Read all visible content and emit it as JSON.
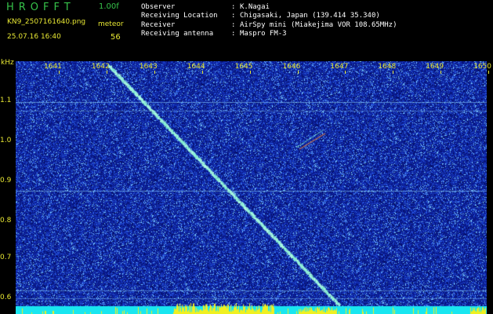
{
  "header": {
    "app_title": "HROFFT",
    "version": "1.00f",
    "filename": "KN9_2507161640.png",
    "datetime": "25.07.16 16:40",
    "mode_label": "meteor",
    "mode_value": "56"
  },
  "info": [
    {
      "label": "Observer",
      "sep": ":",
      "value": "K.Nagai"
    },
    {
      "label": "Receiving Location",
      "sep": ":",
      "value": "Chigasaki, Japan (139.414 35.340)"
    },
    {
      "label": "Receiver",
      "sep": ":",
      "value": "AirSpy mini (Miakejima VOR 108.65MHz)"
    },
    {
      "label": "Receiving antenna",
      "sep": ":",
      "value": "Maspro FM-3"
    }
  ],
  "spectrogram": {
    "y_unit": "kHz",
    "y_ticks": [
      "1.1",
      "1.0",
      "0.9",
      "0.8",
      "0.7",
      "0.6"
    ],
    "x_ticks": [
      "1641",
      "1642",
      "1643",
      "1644",
      "1645",
      "1646",
      "1647",
      "1648",
      "1649",
      "1650"
    ],
    "colors": {
      "background": "#0a1a8c",
      "noise_high": "#8fd8ff",
      "signal": "#7cf0d0",
      "bottom_band": "#19e6f0",
      "bottom_peaks": "#f0f020",
      "labels": "#e6e633"
    }
  }
}
